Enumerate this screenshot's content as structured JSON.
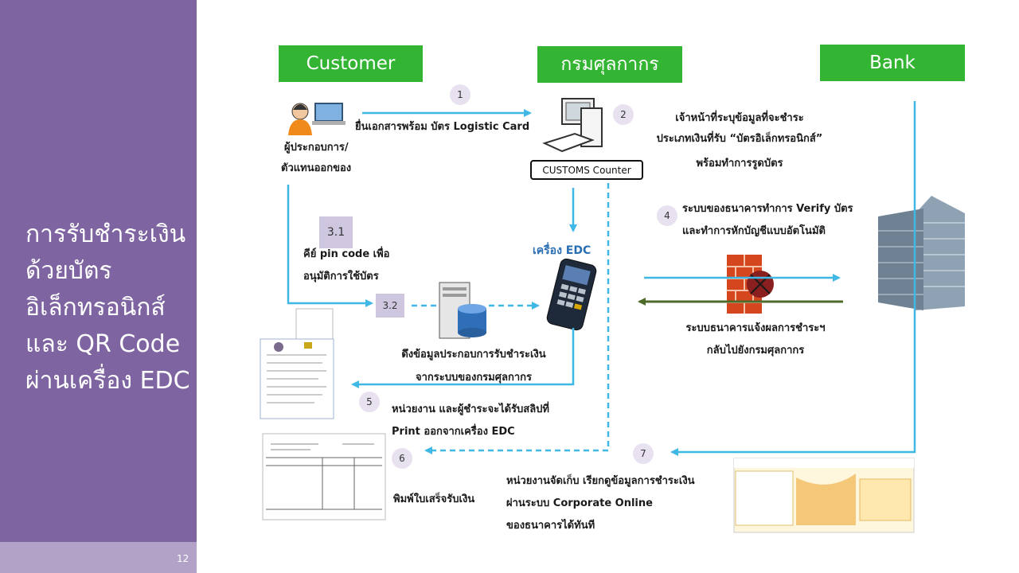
{
  "sidebar": {
    "title_lines": [
      "การรับชำระเงิน",
      "ด้วยบัตร",
      "อิเล็กทรอนิกส์",
      "และ QR Code",
      "ผ่านเครื่อง EDC"
    ],
    "page_number": "12"
  },
  "lanes": {
    "customer": "Customer",
    "customs": "กรมศุลกากร",
    "bank": "Bank"
  },
  "steps": {
    "s1": "1",
    "s2": "2",
    "s3_1": "3.1",
    "s3_2": "3.2",
    "s4": "4",
    "s5": "5",
    "s6": "6",
    "s7": "7"
  },
  "labels": {
    "submit_docs": "ยื่นเอกสารพร้อม บัตร Logistic Card",
    "operator_1": "ผู้ประกอบการ/",
    "operator_2": "ตัวแทนออกของ",
    "counter": "CUSTOMS Counter",
    "officer_1": "เจ้าหน้าที่ระบุข้อมูลที่จะชำระ",
    "officer_2": "ประเภทเงินที่รับ “บัตรอิเล็กทรอนิกส์”",
    "officer_3": "พร้อมทำการรูดบัตร",
    "pin_1": "คีย์ pin code เพื่อ",
    "pin_2": "อนุมัติการใช้บัตร",
    "edc": "เครื่อง EDC",
    "verify_1": "ระบบของธนาคารทำการ Verify บัตร",
    "verify_2": "และทำการหักบัญชีแบบอัตโนมัติ",
    "fetch_1": "ดึงข้อมูลประกอบการรับชำระเงิน",
    "fetch_2": "จากระบบของกรมศุลกากร",
    "bank_notify_1": "ระบบธนาคารแจ้งผลการชำระฯ",
    "bank_notify_2": "กลับไปยังกรมศุลกากร",
    "slip_1": "หน่วยงาน และผู้ชำระจะได้รับสลิปที่",
    "slip_2": "Print ออกจากเครื่อง EDC",
    "receipt": "พิมพ์ใบเสร็จรับเงิน",
    "corp_1": "หน่วยงานจัดเก็บ เรียกดูข้อมูลการชำระเงิน",
    "corp_2": "ผ่านระบบ Corporate Online",
    "corp_3": "ของธนาคารได้ทันที"
  },
  "colors": {
    "sidebar": "#7e64a0",
    "lane_header": "#33b533",
    "arrow_blue": "#3fb8e6",
    "arrow_green": "#4f6b2a",
    "step_badge": "#e7e1f0"
  }
}
